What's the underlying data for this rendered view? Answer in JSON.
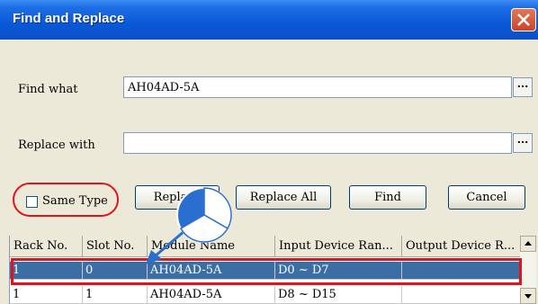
{
  "window": {
    "title": "Find and Replace"
  },
  "find": {
    "label": "Find what",
    "value": "AH04AD-5A",
    "browse": "..."
  },
  "replace": {
    "label": "Replace with",
    "value": "",
    "browse": "..."
  },
  "options": {
    "same_type_label": "Same Type",
    "same_type_checked": false
  },
  "buttons": {
    "replace": "Replace",
    "replace_all": "Replace All",
    "find": "Find",
    "cancel": "Cancel"
  },
  "table": {
    "columns": [
      "Rack No.",
      "Slot No.",
      "Module Name",
      "Input Device Ran...",
      "Output Device R..."
    ],
    "rows": [
      {
        "rack": "1",
        "slot": "0",
        "module": "AH04AD-5A",
        "input": "D0 ~ D7",
        "output": "",
        "selected": true
      },
      {
        "rack": "1",
        "slot": "1",
        "module": "AH04AD-5A",
        "input": "D8 ~ D15",
        "output": "",
        "selected": false
      }
    ]
  },
  "colors": {
    "title_bar": "#0a58d8",
    "selection": "#3a6ea5",
    "highlight": "#e0141b",
    "pie": "#2a6fd0"
  },
  "icons": [
    "close-icon",
    "scroll-up-icon",
    "scroll-down-icon",
    "pointer-arrow-icon",
    "step-pie-icon"
  ]
}
